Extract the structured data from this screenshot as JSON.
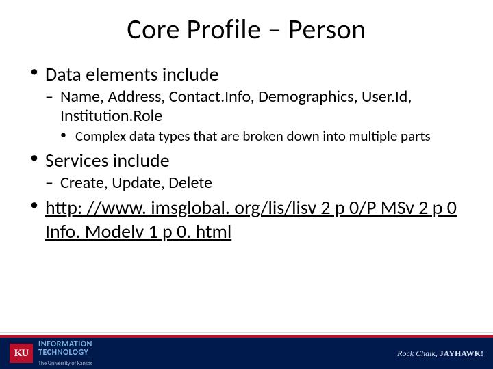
{
  "title": "Core Profile – Person",
  "bullets": {
    "b1": "Data elements include",
    "b1_1": "Name, Address, Contact.Info, Demographics, User.Id, Institution.Role",
    "b1_1_1": "Complex data types that are broken down into multiple parts",
    "b2": "Services include",
    "b2_1": "Create, Update, Delete",
    "b3": "http: //www. imsglobal. org/lis/lisv 2 p 0/P MSv 2 p 0 Info. Modelv 1 p 0. html"
  },
  "footer": {
    "logo_text": "KU",
    "line1": "INFORMATION",
    "line2": "TECHNOLOGY",
    "line3": "The University of Kansas",
    "tagline_prefix": "Rock Chalk, ",
    "tagline_bold": "JAYHAWK!"
  }
}
